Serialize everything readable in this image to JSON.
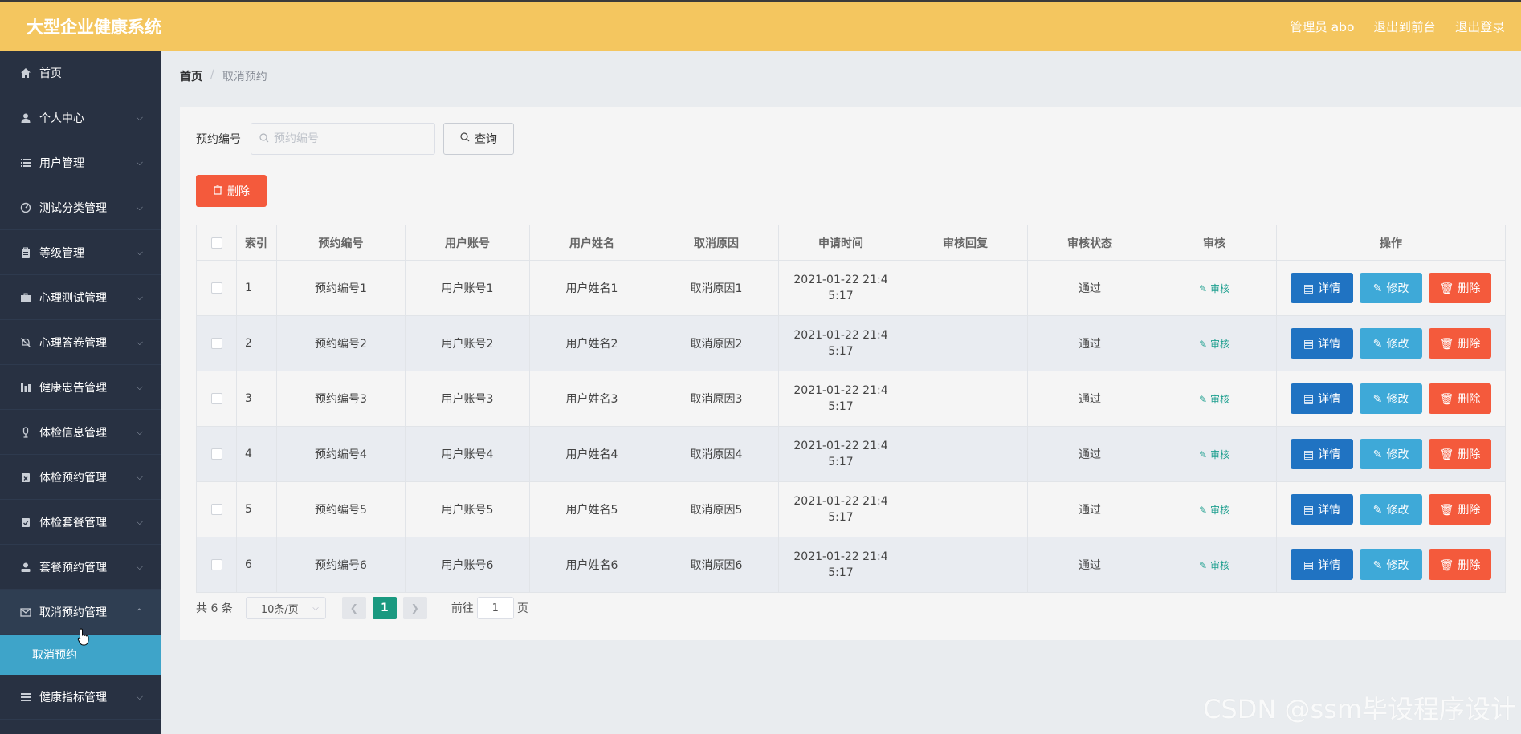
{
  "header": {
    "title": "大型企业健康系统",
    "admin_label": "管理员 abo",
    "exit_front_label": "退出到前台",
    "logout_label": "退出登录"
  },
  "sidebar": {
    "items": [
      {
        "label": "首页",
        "icon": "home-icon",
        "has_chevron": false
      },
      {
        "label": "个人中心",
        "icon": "user-icon",
        "has_chevron": true
      },
      {
        "label": "用户管理",
        "icon": "list-icon",
        "has_chevron": true
      },
      {
        "label": "测试分类管理",
        "icon": "gauge-icon",
        "has_chevron": true
      },
      {
        "label": "等级管理",
        "icon": "clipboard-icon",
        "has_chevron": true
      },
      {
        "label": "心理测试管理",
        "icon": "briefcase-icon",
        "has_chevron": true
      },
      {
        "label": "心理答卷管理",
        "icon": "bell-off-icon",
        "has_chevron": true
      },
      {
        "label": "健康忠告管理",
        "icon": "chart-bars-icon",
        "has_chevron": true
      },
      {
        "label": "体检信息管理",
        "icon": "mic-icon",
        "has_chevron": true
      },
      {
        "label": "体检预约管理",
        "icon": "calendar-x-icon",
        "has_chevron": true
      },
      {
        "label": "体检套餐管理",
        "icon": "clipboard-check-icon",
        "has_chevron": true
      },
      {
        "label": "套餐预约管理",
        "icon": "person-icon",
        "has_chevron": true
      },
      {
        "label": "取消预约管理",
        "icon": "mail-icon",
        "has_chevron": true,
        "open": true
      },
      {
        "label": "健康指标管理",
        "icon": "menu-icon",
        "has_chevron": true
      }
    ],
    "active_sub_item": "取消预约"
  },
  "breadcrumb": {
    "home": "首页",
    "separator": "/",
    "current": "取消预约"
  },
  "search": {
    "label": "预约编号",
    "placeholder": "预约编号",
    "value": "",
    "query_label": "查询"
  },
  "toolbar": {
    "delete_label": "删除"
  },
  "table": {
    "headers": [
      "索引",
      "预约编号",
      "用户账号",
      "用户姓名",
      "取消原因",
      "申请时间",
      "审核回复",
      "审核状态",
      "审核",
      "操作"
    ],
    "rows": [
      {
        "index": "1",
        "booking_no": "预约编号1",
        "account": "用户账号1",
        "name": "用户姓名1",
        "reason": "取消原因1",
        "time": "2021-01-22 21:45:17",
        "reply": "",
        "status": "通过"
      },
      {
        "index": "2",
        "booking_no": "预约编号2",
        "account": "用户账号2",
        "name": "用户姓名2",
        "reason": "取消原因2",
        "time": "2021-01-22 21:45:17",
        "reply": "",
        "status": "通过"
      },
      {
        "index": "3",
        "booking_no": "预约编号3",
        "account": "用户账号3",
        "name": "用户姓名3",
        "reason": "取消原因3",
        "time": "2021-01-22 21:45:17",
        "reply": "",
        "status": "通过"
      },
      {
        "index": "4",
        "booking_no": "预约编号4",
        "account": "用户账号4",
        "name": "用户姓名4",
        "reason": "取消原因4",
        "time": "2021-01-22 21:45:17",
        "reply": "",
        "status": "通过"
      },
      {
        "index": "5",
        "booking_no": "预约编号5",
        "account": "用户账号5",
        "name": "用户姓名5",
        "reason": "取消原因5",
        "time": "2021-01-22 21:45:17",
        "reply": "",
        "status": "通过"
      },
      {
        "index": "6",
        "booking_no": "预约编号6",
        "account": "用户账号6",
        "name": "用户姓名6",
        "reason": "取消原因6",
        "time": "2021-01-22 21:45:17",
        "reply": "",
        "status": "通过"
      }
    ],
    "audit_label": "审核",
    "detail_label": "详情",
    "edit_label": "修改",
    "delete_label": "删除"
  },
  "pagination": {
    "total_text": "共 6 条",
    "page_size": "10条/页",
    "current_page": "1",
    "goto_prefix": "前往",
    "goto_value": "1",
    "goto_suffix": "页"
  },
  "watermark": "CSDN @ssm毕设程序设计",
  "colors": {
    "header_bg": "#f4c65f",
    "sidebar_bg": "#283142",
    "submenu_active_bg": "#3ea4c9",
    "detail_btn": "#2073c2",
    "edit_btn": "#3ea9d8",
    "delete_btn": "#f45a3c",
    "page_active": "#1a9980",
    "audit_link": "#20a090"
  }
}
